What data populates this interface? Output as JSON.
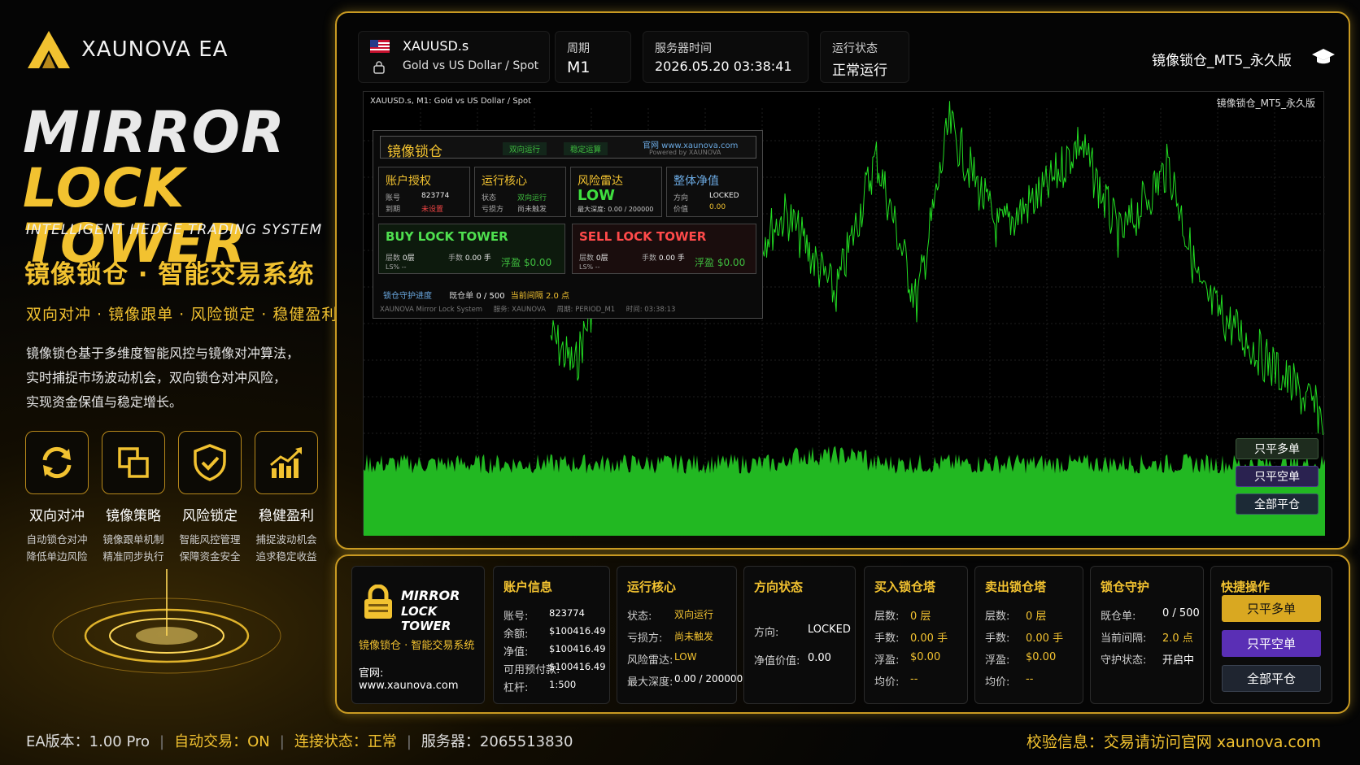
{
  "brand": {
    "name": "XAUNOVA EA",
    "title_line1": "MIRROR",
    "title_line2": "LOCK TOWER",
    "subtitle_en": "INTELLIGENT HEDGE TRADING SYSTEM",
    "subtitle_cn": "镜像锁仓 · 智能交易系统",
    "tagline": "双向对冲 · 镜像跟单 · 风险锁定 · 稳健盈利",
    "desc1": "镜像锁仓基于多维度智能风控与镜像对冲算法，",
    "desc2": "实时捕捉市场波动机会，双向锁仓对冲风险，",
    "desc3": "实现资金保值与稳定增长。"
  },
  "features": [
    {
      "icon": "refresh-icon",
      "title": "双向对冲",
      "d1": "自动锁仓对冲",
      "d2": "降低单边风险"
    },
    {
      "icon": "mirror-icon",
      "title": "镜像策略",
      "d1": "镜像跟单机制",
      "d2": "精准同步执行"
    },
    {
      "icon": "shield-check-icon",
      "title": "风险锁定",
      "d1": "智能风控管理",
      "d2": "保障资金安全"
    },
    {
      "icon": "growth-chart-icon",
      "title": "稳健盈利",
      "d1": "捕捉波动机会",
      "d2": "追求稳定收益"
    }
  ],
  "footer": {
    "ea_version": "EA版本：1.00 Pro",
    "auto_trade": "自动交易：ON",
    "connection": "连接状态：正常",
    "server": "服务器：2065513830",
    "verify": "校验信息：交易请访问官网 xaunova.com",
    "sep": "|"
  },
  "header": {
    "symbol": "XAUUSD.s",
    "symbol_desc": "Gold vs US Dollar / Spot",
    "period_label": "周期",
    "period_value": "M1",
    "time_label": "服务器时间",
    "time_value": "2026.05.20 03:38:41",
    "status_label": "运行状态",
    "status_value": "正常运行",
    "product": "镜像锁仓_MT5_永久版"
  },
  "chart": {
    "title": "XAUUSD.s, M1: Gold vs US Dollar / Spot",
    "product": "镜像锁仓_MT5_永久版",
    "buttons": [
      "只平多单",
      "只平空单",
      "全部平仓"
    ],
    "grid": true,
    "series_color": "#22dd22"
  },
  "overlay": {
    "title": "镜像锁仓",
    "tag1": "双向运行",
    "tag2": "稳定运算",
    "site": "官网  www.xaunova.com",
    "powered": "Powered by XAUNOVA",
    "card1": {
      "h": "账户授权",
      "k1": "账号",
      "v1": "823774",
      "k2": "到期",
      "v2": "未设置"
    },
    "card2": {
      "h": "运行核心",
      "k1": "状态",
      "v1": "双向运行",
      "k2": "亏损方",
      "v2": "尚未触发"
    },
    "card3": {
      "h": "风险雷达",
      "big": "LOW",
      "k2": "最大深度: 0.00 / 200000"
    },
    "card4": {
      "h": "整体净值",
      "k1": "方向",
      "v1": "LOCKED",
      "k2": "价值",
      "v2": "0.00"
    },
    "buy": {
      "title": "BUY LOCK TOWER",
      "k1": "层数",
      "v1": "0层",
      "k2": "手数",
      "v2": "0.00 手",
      "k3": "LS%",
      "v3": "--",
      "k4": "浮盈",
      "v4": "$0.00"
    },
    "sell": {
      "title": "SELL LOCK TOWER",
      "k1": "层数",
      "v1": "0层",
      "k2": "手数",
      "v2": "0.00 手",
      "k3": "LS%",
      "v3": "--",
      "k4": "浮盈",
      "v4": "$0.00"
    },
    "progress": {
      "label": "锁仓守护进度",
      "k": "既仓单",
      "v": "0 / 500",
      "k2": "当前间隔",
      "v2": "2.0",
      "u": "点"
    },
    "foot": "XAUNOVA Mirror Lock System     服务: XAUNOVA     周期: PERIOD_M1     时间: 03:38:13"
  },
  "panel": {
    "logo_l1": "MIRROR",
    "logo_l2": "LOCK TOWER",
    "logo_cn": "镜像锁仓 · 智能交易系统",
    "logo_site": "官网: www.xaunova.com",
    "account": {
      "h": "账户信息",
      "rows": [
        [
          "账号:",
          "823774"
        ],
        [
          "余额:",
          "$100416.49"
        ],
        [
          "净值:",
          "$100416.49"
        ],
        [
          "可用预付款:",
          "$100416.49"
        ],
        [
          "杠杆:",
          "1:500"
        ]
      ]
    },
    "core": {
      "h": "运行核心",
      "rows": [
        [
          "状态:",
          "双向运行"
        ],
        [
          "亏损方:",
          "尚未触发"
        ],
        [
          "风险雷达:",
          "LOW"
        ],
        [
          "最大深度:",
          "0.00 / 200000"
        ]
      ]
    },
    "direction": {
      "h": "方向状态",
      "rows": [
        [
          "方向:",
          "LOCKED"
        ],
        [
          "净值价值:",
          "0.00"
        ]
      ]
    },
    "buy": {
      "h": "买入锁仓塔",
      "rows": [
        [
          "层数:",
          "0 层"
        ],
        [
          "手数:",
          "0.00 手"
        ],
        [
          "浮盈:",
          "$0.00"
        ],
        [
          "均价:",
          "--"
        ]
      ]
    },
    "sell": {
      "h": "卖出锁仓塔",
      "rows": [
        [
          "层数:",
          "0 层"
        ],
        [
          "手数:",
          "0.00 手"
        ],
        [
          "浮盈:",
          "$0.00"
        ],
        [
          "均价:",
          "--"
        ]
      ]
    },
    "guard": {
      "h": "锁仓守护",
      "rows": [
        [
          "既仓单:",
          "0 / 500"
        ],
        [
          "当前间隔:",
          "2.0 点"
        ],
        [
          "守护状态:",
          "开启中"
        ]
      ]
    },
    "quick": {
      "h": "快捷操作",
      "b1": "只平多单",
      "b2": "只平空单",
      "b3": "全部平仓"
    }
  }
}
